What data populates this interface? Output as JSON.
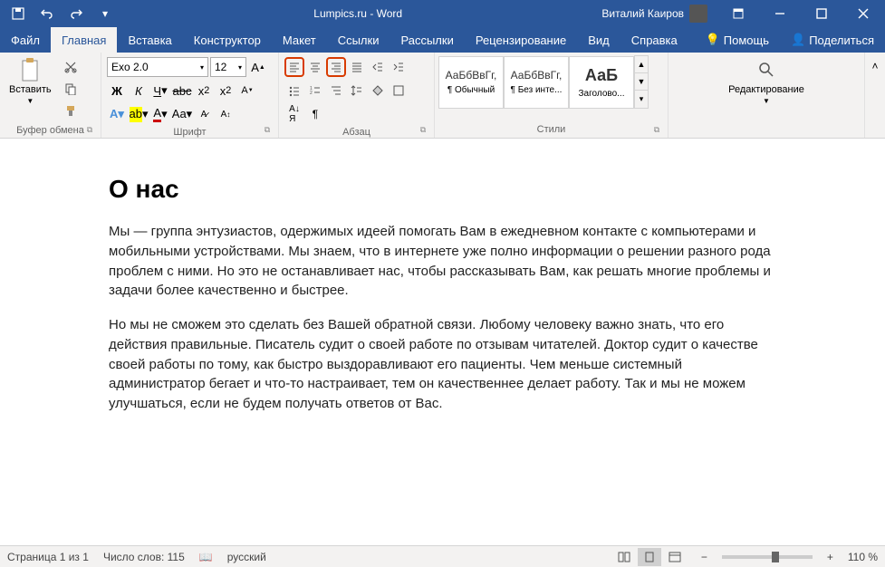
{
  "titlebar": {
    "app_title": "Lumpics.ru - Word",
    "user_name": "Виталий Каиров"
  },
  "tabs": {
    "file": "Файл",
    "home": "Главная",
    "insert": "Вставка",
    "design": "Конструктор",
    "layout": "Макет",
    "references": "Ссылки",
    "mailings": "Рассылки",
    "review": "Рецензирование",
    "view": "Вид",
    "help": "Справка",
    "tell_me": "Помощь",
    "share": "Поделиться"
  },
  "ribbon": {
    "clipboard": {
      "label": "Буфер обмена",
      "paste": "Вставить"
    },
    "font": {
      "label": "Шрифт",
      "font_name": "Exo 2.0",
      "font_size": "12"
    },
    "paragraph": {
      "label": "Абзац"
    },
    "styles": {
      "label": "Стили",
      "normal_preview": "АаБбВвГг,",
      "normal_name": "¶ Обычный",
      "nospacing_preview": "АаБбВвГг,",
      "nospacing_name": "¶ Без инте...",
      "heading_preview": "АаБ",
      "heading_name": "Заголово..."
    },
    "editing": {
      "label": "Редактирование"
    }
  },
  "document": {
    "heading": "О нас",
    "p1": "Мы — группа энтузиастов, одержимых идеей помогать Вам в ежедневном контакте с компьютерами и мобильными устройствами. Мы знаем, что в интернете уже полно информации о решении разного рода проблем с ними. Но это не останавливает нас, чтобы рассказывать Вам, как решать многие проблемы и задачи более качественно и быстрее.",
    "p2": "Но мы не сможем это сделать без Вашей обратной связи. Любому человеку важно знать, что его действия правильные. Писатель судит о своей работе по отзывам читателей. Доктор судит о качестве своей работы по тому, как быстро выздоравливают его пациенты. Чем меньше системный администратор бегает и что-то настраивает, тем он качественнее делает работу. Так и мы не можем улучшаться, если не будем получать ответов от Вас."
  },
  "statusbar": {
    "page": "Страница 1 из 1",
    "words": "Число слов: 115",
    "language": "русский",
    "zoom": "110 %"
  }
}
